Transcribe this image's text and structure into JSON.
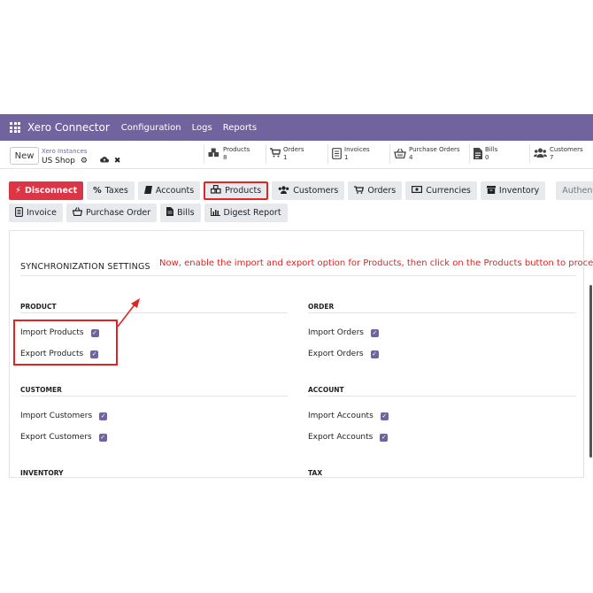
{
  "topbar": {
    "brand": "Xero Connector",
    "menu": [
      "Configuration",
      "Logs",
      "Reports"
    ]
  },
  "control": {
    "new_label": "New",
    "breadcrumb_parent": "Xero Instances",
    "breadcrumb_current": "US Shop"
  },
  "stats": [
    {
      "label": "Products",
      "value": "8",
      "icon": "cubes-icon"
    },
    {
      "label": "Orders",
      "value": "1",
      "icon": "cart-icon"
    },
    {
      "label": "Invoices",
      "value": "1",
      "icon": "invoice-icon"
    },
    {
      "label": "Purchase Orders",
      "value": "4",
      "icon": "basket-icon"
    },
    {
      "label": "Bills",
      "value": "0",
      "icon": "file-icon"
    },
    {
      "label": "Customers",
      "value": "7",
      "icon": "users-icon"
    }
  ],
  "buttons_row1": {
    "disconnect": "Disconnect",
    "taxes": "Taxes",
    "accounts": "Accounts",
    "products": "Products",
    "customers": "Customers",
    "orders": "Orders",
    "currencies": "Currencies",
    "inventory": "Inventory",
    "authenticated": "Authenticated"
  },
  "buttons_row2": {
    "invoice": "Invoice",
    "purchase_order": "Purchase Order",
    "bills": "Bills",
    "digest_report": "Digest Report"
  },
  "section_title": "SYNCHRONIZATION SETTINGS",
  "instruction_note": "Now, enable the import and export option for Products, then click on the Products button to proceed.",
  "groups": {
    "product": {
      "title": "PRODUCT",
      "import": "Import Products",
      "export": "Export Products",
      "import_checked": true,
      "export_checked": true
    },
    "order": {
      "title": "ORDER",
      "import": "Import Orders",
      "export": "Export Orders",
      "import_checked": true,
      "export_checked": true
    },
    "customer": {
      "title": "CUSTOMER",
      "import": "Import Customers",
      "export": "Export Customers",
      "import_checked": true,
      "export_checked": true
    },
    "account": {
      "title": "ACCOUNT",
      "import": "Import Accounts",
      "export": "Export Accounts",
      "import_checked": true,
      "export_checked": true
    },
    "inventory": {
      "title": "INVENTORY"
    },
    "tax": {
      "title": "TAX"
    }
  },
  "colors": {
    "brand_purple": "#71639e",
    "danger_red": "#dc3545",
    "annotation_red": "#e02424"
  }
}
